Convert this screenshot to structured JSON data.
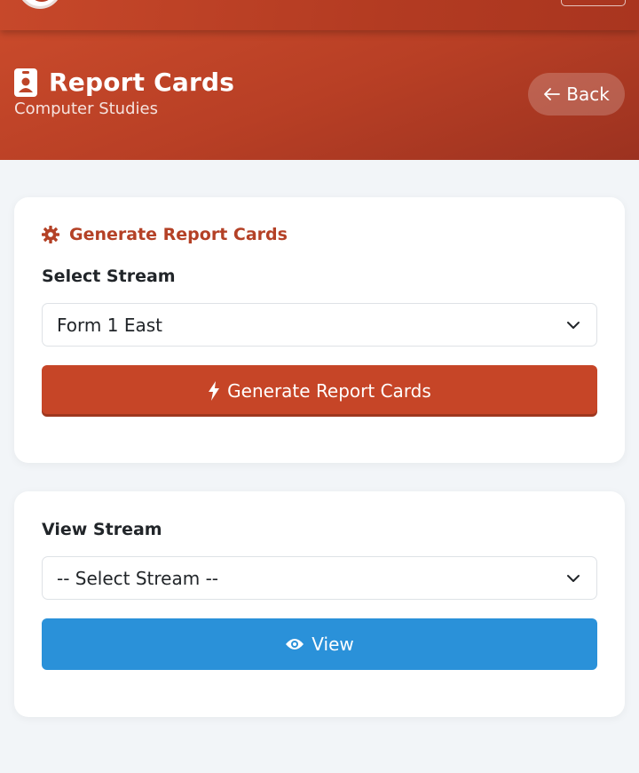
{
  "header": {
    "title": "Report Cards",
    "subtitle": "Computer Studies",
    "back_label": "Back"
  },
  "generate_card": {
    "heading": "Generate Report Cards",
    "stream_label": "Select Stream",
    "stream_value": "Form 1 East",
    "button_label": "Generate Report Cards"
  },
  "view_card": {
    "stream_label": "View Stream",
    "stream_value": "-- Select Stream --",
    "button_label": "View"
  },
  "colors": {
    "primary": "#c64527",
    "info": "#2a91d9",
    "heading_accent": "#b44126"
  },
  "icons": {
    "title": "id-badge-icon",
    "back": "arrow-left-icon",
    "heading": "gear-icon",
    "generate": "bolt-icon",
    "view": "eye-icon",
    "select": "chevron-down-icon"
  }
}
